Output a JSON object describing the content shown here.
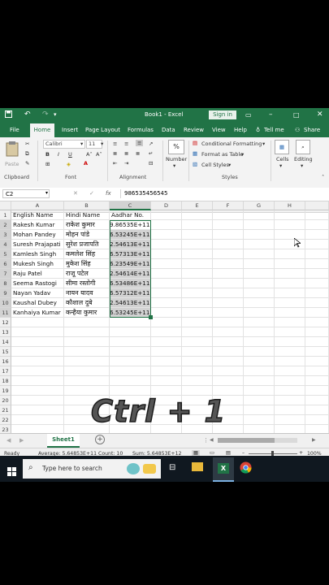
{
  "titlebar": {
    "title": "Book1 - Excel",
    "signin": "Sign in"
  },
  "menu": [
    "File",
    "Home",
    "Insert",
    "Page Layout",
    "Formulas",
    "Data",
    "Review",
    "View",
    "Help",
    "Tell me",
    "Share"
  ],
  "ribbon": {
    "paste": "Paste",
    "font_name": "Calibri",
    "font_size": "11",
    "bold": "B",
    "italic": "I",
    "underline": "U",
    "number": "Number",
    "percent": "%",
    "conditional_formatting": "Conditional Formatting",
    "format_as_table": "Format as Table",
    "cell_styles": "Cell Styles",
    "cells": "Cells",
    "editing": "Editing",
    "groups": {
      "clipboard": "Clipboard",
      "font": "Font",
      "alignment": "Alignment",
      "styles": "Styles"
    }
  },
  "formula_bar": {
    "name_box": "C2",
    "cancel": "✕",
    "enter": "✓",
    "fx": "fx",
    "content": "986535456545"
  },
  "columns": [
    "A",
    "B",
    "C",
    "D",
    "E",
    "F",
    "G",
    "H"
  ],
  "rows": [
    "1",
    "2",
    "3",
    "4",
    "5",
    "6",
    "7",
    "8",
    "9",
    "10",
    "11",
    "12",
    "13",
    "14",
    "15",
    "16",
    "17",
    "18",
    "19",
    "20",
    "21",
    "22",
    "23"
  ],
  "table": {
    "headers": [
      "English Name",
      "Hindi Name",
      "Aadhar No."
    ],
    "records": [
      [
        "Rakesh Kumar",
        "राकेश कुमार",
        "9.86535E+11"
      ],
      [
        "Mohan Pandey",
        "मोहन पांडे",
        "6.53245E+11"
      ],
      [
        "Suresh Prajapati",
        "सुरेश प्रजापति",
        "2.54613E+11"
      ],
      [
        "Kamlesh Singh",
        "कमलेश सिंह",
        "6.57313E+11"
      ],
      [
        "Mukesh Singh",
        "मुकेश सिंह",
        "6.23549E+11"
      ],
      [
        "Raju Patel",
        "राजू पटेल",
        "2.54614E+11"
      ],
      [
        "Seema Rastogi",
        "सीमा रस्तोगी",
        "6.53486E+11"
      ],
      [
        "Nayan Yadav",
        "नायन यादव",
        "6.57312E+11"
      ],
      [
        "Kaushal Dubey",
        "कौशाल दुबे",
        "2.54613E+11"
      ],
      [
        "Kanhaiya Kumar",
        "कन्हैया कुमार",
        "6.53245E+11"
      ]
    ]
  },
  "overlay_text": "Ctrl + 1",
  "sheet_tab": "Sheet1",
  "status": {
    "ready": "Ready",
    "average": "Average: 5.64853E+11",
    "count": "Count: 10",
    "sum": "Sum: 5.64853E+12",
    "zoom": "100%"
  },
  "taskbar": {
    "search_placeholder": "Type here to search"
  },
  "colors": {
    "excel_green": "#217346",
    "selection": "#d2d2d2"
  }
}
